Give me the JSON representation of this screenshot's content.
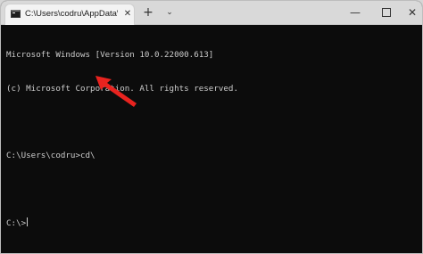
{
  "window": {
    "tab_title": "C:\\Users\\codru\\AppData\\Roa",
    "tab_close": "✕",
    "new_tab": "+",
    "dropdown": "⌄",
    "minimize": "—",
    "close": "✕"
  },
  "console": {
    "lines": [
      "Microsoft Windows [Version 10.0.22000.613]",
      "(c) Microsoft Corporation. All rights reserved.",
      "",
      "C:\\Users\\codru>cd\\",
      "",
      "C:\\>"
    ]
  },
  "colors": {
    "background": "#0c0c0c",
    "text": "#cccccc",
    "titlebar": "#d9d9d9",
    "arrow": "#e8231f"
  }
}
